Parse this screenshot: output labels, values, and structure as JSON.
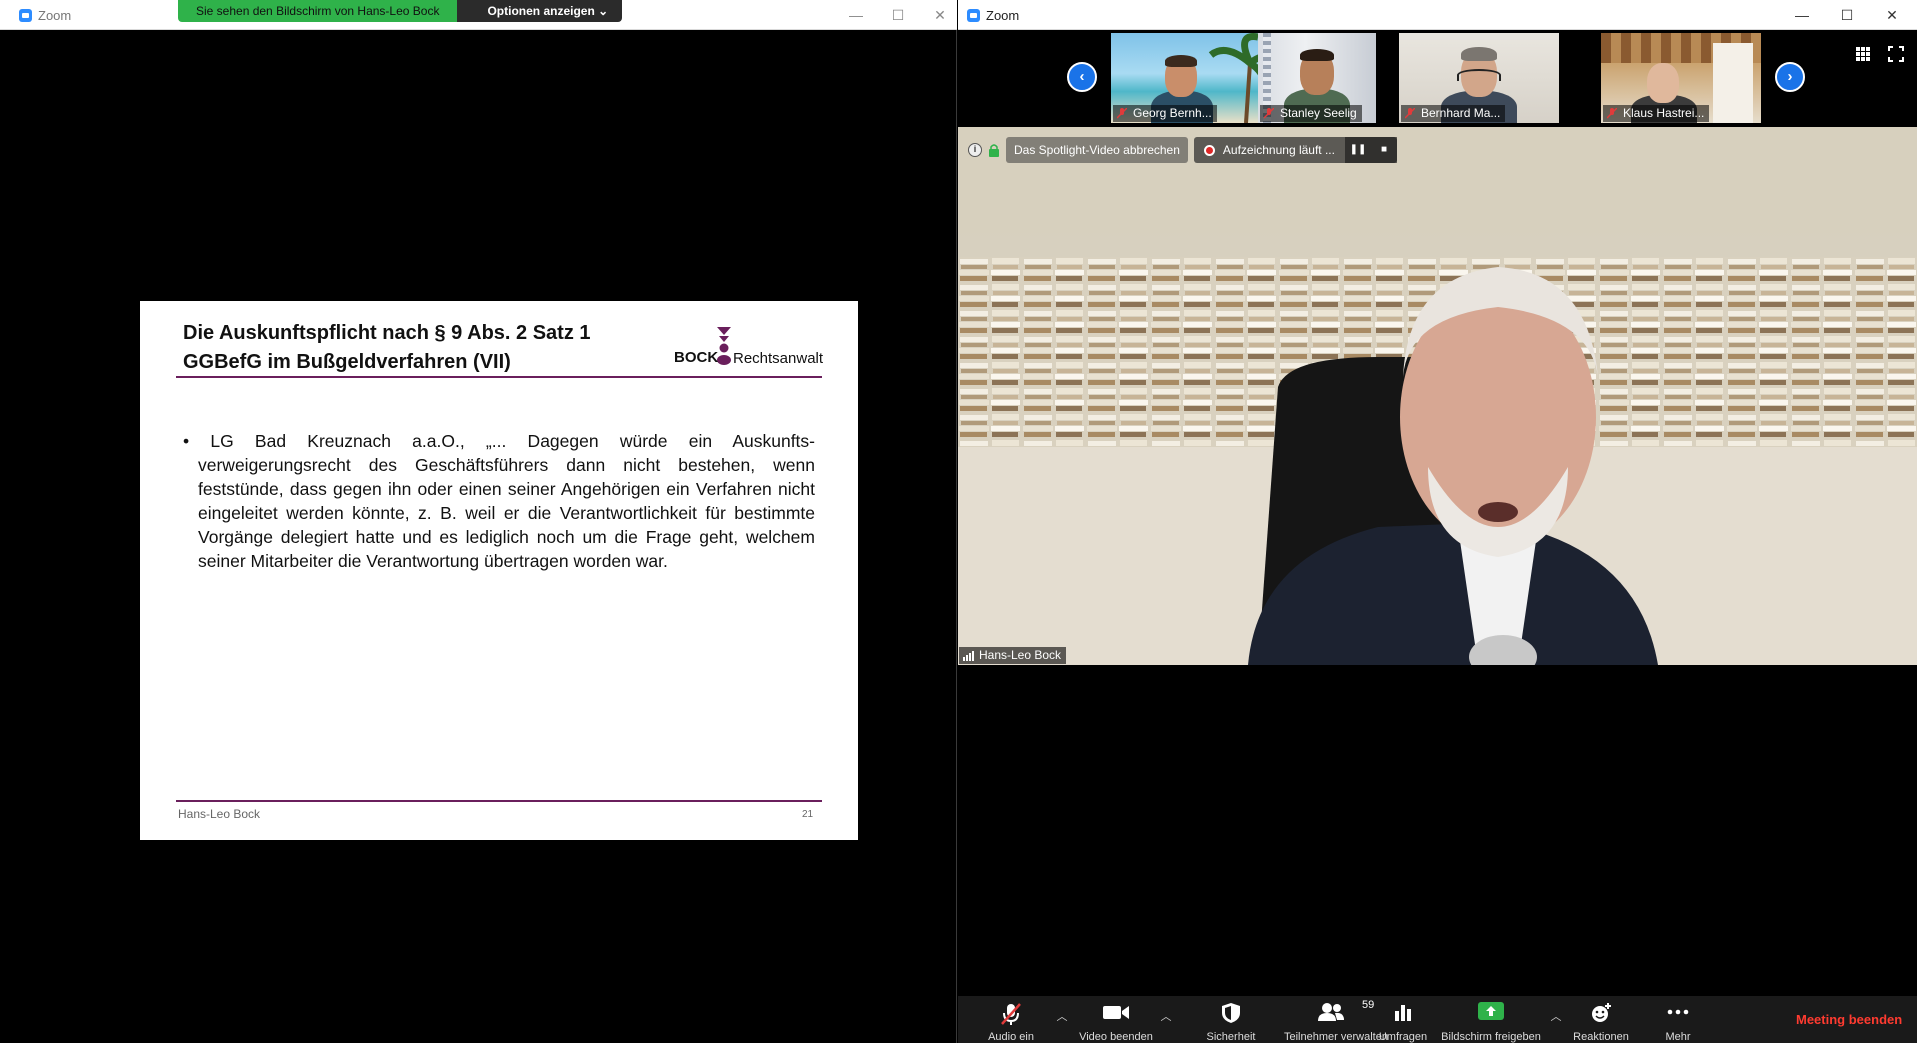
{
  "left_window": {
    "title": "Zoom",
    "share_banner": {
      "viewing_text": "Sie sehen den Bildschirm von Hans-Leo Bock",
      "options_label": "Optionen anzeigen"
    },
    "slide": {
      "title_line1": "Die Auskunftspflicht nach § 9 Abs. 2 Satz 1",
      "title_line2": "GGBefG im Bußgeldverfahren (VII)",
      "logo_bock": "BOCK",
      "logo_rechtsanwalt": "Rechtsanwalt",
      "body": "• LG Bad Kreuznach a.a.O., „... Dagegen würde ein Auskunfts-verweigerungsrecht des Geschäftsführers dann nicht bestehen, wenn feststünde, dass gegen ihn oder einen seiner Angehörigen ein Verfahren nicht eingeleitet werden könnte, z. B. weil er die Verantwortlichkeit für bestimmte Vorgänge delegiert hatte und es lediglich noch um die Frage geht, welchem seiner Mitarbeiter die Verantwortung übertragen worden war.",
      "footer_name": "Hans-Leo Bock",
      "page_number": "21"
    }
  },
  "right_window": {
    "title": "Zoom",
    "thumbnails": [
      {
        "name": "Georg Bernh..."
      },
      {
        "name": "Stanley Seelig"
      },
      {
        "name": "Bernhard Ma..."
      },
      {
        "name": "Klaus Hastrei..."
      }
    ],
    "video_toolbar": {
      "cancel_spotlight": "Das Spotlight-Video abbrechen",
      "recording": "Aufzeichnung läuft ..."
    },
    "speaker_name": "Hans-Leo Bock",
    "bottom_toolbar": {
      "audio": "Audio ein",
      "video": "Video beenden",
      "security": "Sicherheit",
      "participants": "Teilnehmer verwalten",
      "participant_count": "59",
      "polls": "Umfragen",
      "share": "Bildschirm freigeben",
      "reactions": "Reaktionen",
      "more": "Mehr",
      "end": "Meeting beenden"
    }
  },
  "colors": {
    "accent": "#2d8cff",
    "slide_rule": "#6a1f5c",
    "share_green": "#2fb24a",
    "end_red": "#ff3b30"
  }
}
